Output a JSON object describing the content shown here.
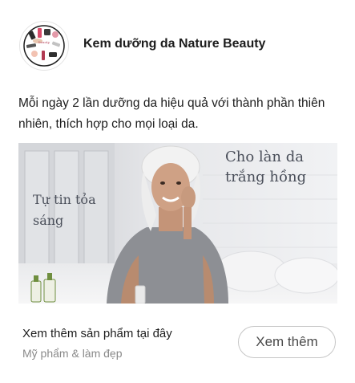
{
  "ad": {
    "page_name": "Kem dưỡng da Nature Beauty",
    "caption": "Mỗi ngày 2 lần dưỡng da hiệu quả với thành phần thiên nhiên, thích hợp cho mọi loại da.",
    "image_text_primary": "Cho làn da trắng hồng",
    "image_text_secondary": "Tự tin tỏa sáng",
    "footer_title": "Xem thêm sản phẩm tại đây",
    "footer_subtitle": "Mỹ phẩm & làm đẹp",
    "cta_label": "Xem thêm"
  },
  "colors": {
    "cta_border": "#c6c6c6",
    "subtitle": "#8a8a8a",
    "overlay_text": "#4a4f5a"
  }
}
